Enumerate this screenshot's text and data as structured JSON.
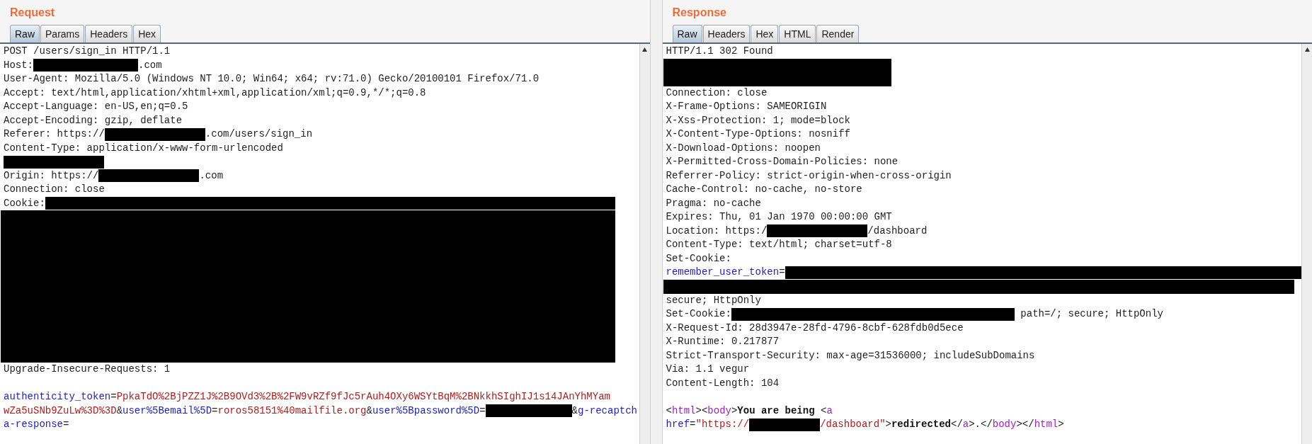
{
  "panels": [
    {
      "title": "Request",
      "tabs": [
        {
          "label": "Raw",
          "selected": true
        },
        {
          "label": "Params",
          "selected": false
        },
        {
          "label": "Headers",
          "selected": false
        },
        {
          "label": "Hex",
          "selected": false
        }
      ],
      "lines": [
        {
          "kind": "line",
          "segments": [
            {
              "kind": "plain",
              "text": "POST /users/sign_in HTTP/1.1"
            }
          ]
        },
        {
          "kind": "line",
          "segments": [
            {
              "kind": "plain",
              "text": "Host:"
            },
            {
              "kind": "mask"
            },
            {
              "kind": "plain",
              "text": ".com"
            }
          ]
        },
        {
          "kind": "line",
          "segments": [
            {
              "kind": "plain",
              "text": "User-Agent: Mozilla/5.0 (Windows NT 10.0; Win64; x64; rv:71.0) Gecko/20100101 Firefox/71.0"
            }
          ]
        },
        {
          "kind": "line",
          "segments": [
            {
              "kind": "plain",
              "text": "Accept: text/html,application/xhtml+xml,application/xml;q=0.9,*/*;q=0.8"
            }
          ]
        },
        {
          "kind": "line",
          "segments": [
            {
              "kind": "plain",
              "text": "Accept-Language: en-US,en;q=0.5"
            }
          ]
        },
        {
          "kind": "line",
          "segments": [
            {
              "kind": "plain",
              "text": "Accept-Encoding: gzip, deflate"
            }
          ]
        },
        {
          "kind": "line",
          "segments": [
            {
              "kind": "plain",
              "text": "Referer: https://"
            },
            {
              "kind": "mask"
            },
            {
              "kind": "plain",
              "text": ".com/users/sign_in"
            }
          ]
        },
        {
          "kind": "line",
          "segments": [
            {
              "kind": "plain",
              "text": "Content-Type: application/x-www-form-urlencoded"
            }
          ]
        },
        {
          "kind": "line",
          "segments": [
            {
              "kind": "mask"
            }
          ]
        },
        {
          "kind": "line",
          "segments": [
            {
              "kind": "plain",
              "text": "Origin: https://"
            },
            {
              "kind": "mask"
            },
            {
              "kind": "plain",
              "text": ".com"
            }
          ]
        },
        {
          "kind": "line",
          "segments": [
            {
              "kind": "plain",
              "text": "Connection: close"
            }
          ]
        },
        {
          "kind": "line",
          "segments": [
            {
              "kind": "selected",
              "text": "Cookie:"
            },
            {
              "kind": "mask"
            }
          ]
        },
        {
          "kind": "block"
        },
        {
          "kind": "line",
          "segments": [
            {
              "kind": "plain",
              "text": "Upgrade-Insecure-Requests: 1"
            }
          ]
        },
        {
          "kind": "blank"
        },
        {
          "kind": "line",
          "segments": [
            {
              "kind": "key",
              "text": "authenticity_token"
            },
            {
              "kind": "plain",
              "text": "="
            },
            {
              "kind": "value",
              "text": "PpkaTdO%2BjPZZ1J%2B9OVd3%2B%2FW9vRZf9fJc5rAuh4OXy6WSYtBqM%2BNkkhSIghIJ1s14JAnYhMYam"
            }
          ]
        },
        {
          "kind": "line",
          "segments": [
            {
              "kind": "value",
              "text": "wZa5uSNb9ZuLw%3D%3D"
            },
            {
              "kind": "plain",
              "text": "&"
            },
            {
              "kind": "key",
              "text": "user%5Bemail%5D"
            },
            {
              "kind": "plain",
              "text": "="
            },
            {
              "kind": "value",
              "text": "roros58151%40mailfile.org"
            },
            {
              "kind": "plain",
              "text": "&"
            },
            {
              "kind": "key",
              "text": "user%5Bpassword%5D"
            },
            {
              "kind": "plain",
              "text": "="
            },
            {
              "kind": "mask"
            },
            {
              "kind": "plain",
              "text": "&"
            },
            {
              "kind": "key",
              "text": "g-recaptch"
            }
          ]
        },
        {
          "kind": "line",
          "segments": [
            {
              "kind": "key",
              "text": "a-response"
            },
            {
              "kind": "plain",
              "text": "="
            }
          ]
        }
      ]
    },
    {
      "title": "Response",
      "tabs": [
        {
          "label": "Raw",
          "selected": true
        },
        {
          "label": "Headers",
          "selected": false
        },
        {
          "label": "Hex",
          "selected": false
        },
        {
          "label": "HTML",
          "selected": false
        },
        {
          "label": "Render",
          "selected": false
        }
      ],
      "lines": [
        {
          "kind": "line",
          "segments": [
            {
              "kind": "plain",
              "text": "HTTP/1.1 302 Found"
            }
          ]
        },
        {
          "kind": "block"
        },
        {
          "kind": "line",
          "segments": [
            {
              "kind": "plain",
              "text": "Connection: close"
            }
          ]
        },
        {
          "kind": "line",
          "segments": [
            {
              "kind": "plain",
              "text": "X-Frame-Options: SAMEORIGIN"
            }
          ]
        },
        {
          "kind": "line",
          "segments": [
            {
              "kind": "plain",
              "text": "X-Xss-Protection: 1; mode=block"
            }
          ]
        },
        {
          "kind": "line",
          "segments": [
            {
              "kind": "plain",
              "text": "X-Content-Type-Options: nosniff"
            }
          ]
        },
        {
          "kind": "line",
          "segments": [
            {
              "kind": "plain",
              "text": "X-Download-Options: noopen"
            }
          ]
        },
        {
          "kind": "line",
          "segments": [
            {
              "kind": "plain",
              "text": "X-Permitted-Cross-Domain-Policies: none"
            }
          ]
        },
        {
          "kind": "line",
          "segments": [
            {
              "kind": "plain",
              "text": "Referrer-Policy: strict-origin-when-cross-origin"
            }
          ]
        },
        {
          "kind": "line",
          "segments": [
            {
              "kind": "plain",
              "text": "Cache-Control: no-cache, no-store"
            }
          ]
        },
        {
          "kind": "line",
          "segments": [
            {
              "kind": "plain",
              "text": "Pragma: no-cache"
            }
          ]
        },
        {
          "kind": "line",
          "segments": [
            {
              "kind": "plain",
              "text": "Expires: Thu, 01 Jan 1970 00:00:00 GMT"
            }
          ]
        },
        {
          "kind": "line",
          "segments": [
            {
              "kind": "plain",
              "text": "Location: https:/"
            },
            {
              "kind": "mask"
            },
            {
              "kind": "plain",
              "text": "/dashboard"
            }
          ]
        },
        {
          "kind": "line",
          "segments": [
            {
              "kind": "plain",
              "text": "Content-Type: text/html; charset=utf-8"
            }
          ]
        },
        {
          "kind": "line",
          "segments": [
            {
              "kind": "plain",
              "text": "Set-Cookie:"
            }
          ]
        },
        {
          "kind": "line",
          "segments": [
            {
              "kind": "key",
              "text": "remember_user_token"
            },
            {
              "kind": "plain",
              "text": "="
            },
            {
              "kind": "mask"
            }
          ]
        },
        {
          "kind": "block"
        },
        {
          "kind": "line",
          "segments": [
            {
              "kind": "plain",
              "text": "secure; HttpOnly"
            }
          ]
        },
        {
          "kind": "line",
          "segments": [
            {
              "kind": "plain",
              "text": "Set-Cookie:"
            },
            {
              "kind": "mask"
            },
            {
              "kind": "plain",
              "text": " path=/; secure; HttpOnly"
            }
          ]
        },
        {
          "kind": "line",
          "segments": [
            {
              "kind": "plain",
              "text": "X-Request-Id: 28d3947e-28fd-4796-8cbf-628fdb0d5ece"
            }
          ]
        },
        {
          "kind": "line",
          "segments": [
            {
              "kind": "plain",
              "text": "X-Runtime: 0.217877"
            }
          ]
        },
        {
          "kind": "line",
          "segments": [
            {
              "kind": "plain",
              "text": "Strict-Transport-Security: max-age=31536000; includeSubDomains"
            }
          ]
        },
        {
          "kind": "line",
          "segments": [
            {
              "kind": "plain",
              "text": "Via: 1.1 vegur"
            }
          ]
        },
        {
          "kind": "line",
          "segments": [
            {
              "kind": "plain",
              "text": "Content-Length: 104"
            }
          ]
        },
        {
          "kind": "blank"
        },
        {
          "kind": "line",
          "segments": [
            {
              "kind": "plain",
              "text": "<"
            },
            {
              "kind": "tag",
              "text": "html"
            },
            {
              "kind": "plain",
              "text": "><"
            },
            {
              "kind": "tag",
              "text": "body"
            },
            {
              "kind": "plain",
              "text": ">"
            },
            {
              "kind": "bold",
              "text": "You are being "
            },
            {
              "kind": "plain",
              "text": "<"
            },
            {
              "kind": "tag",
              "text": "a"
            }
          ]
        },
        {
          "kind": "line",
          "segments": [
            {
              "kind": "key",
              "text": "href"
            },
            {
              "kind": "plain",
              "text": "="
            },
            {
              "kind": "value",
              "text": "\"https://"
            },
            {
              "kind": "mask"
            },
            {
              "kind": "value",
              "text": "/dashboard\""
            },
            {
              "kind": "plain",
              "text": ">"
            },
            {
              "kind": "bold",
              "text": "redirected"
            },
            {
              "kind": "plain",
              "text": "</"
            },
            {
              "kind": "tag",
              "text": "a"
            },
            {
              "kind": "plain",
              "text": ">.</"
            },
            {
              "kind": "tag",
              "text": "body"
            },
            {
              "kind": "plain",
              "text": "></"
            },
            {
              "kind": "tag",
              "text": "html"
            },
            {
              "kind": "plain",
              "text": ">"
            }
          ]
        }
      ]
    }
  ]
}
